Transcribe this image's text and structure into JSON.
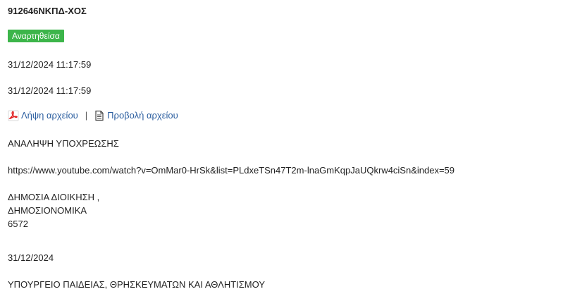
{
  "record": {
    "code": "912646ΝΚΠΔ-ΧΟΣ",
    "status_badge": "Αναρτηθείσα",
    "colors": {
      "badge_bg": "#3cb54a",
      "link": "#2a5d9f"
    },
    "submission_timestamp": "31/12/2024 11:17:59",
    "published_timestamp": "31/12/2024 11:17:59",
    "files": {
      "download_label": "Λήψη αρχείου",
      "download_icon": "pdf-icon",
      "separator": "|",
      "view_label": "Προβολή αρχείου",
      "view_icon": "document-icon"
    },
    "decision_type": "ΑΝΑΛΗΨΗ ΥΠΟΧΡΕΩΣΗΣ",
    "url": "https://www.youtube.com/watch?v=OmMar0-HrSk&list=PLdxeTSn47T2m-lnaGmKqpJaUQkrw4ciSn&index=59",
    "thematic_units": {
      "line1": "ΔΗΜΟΣΙΑ ΔΙΟΙΚΗΣΗ ,",
      "line2": "ΔΗΜΟΣΙΟΝΟΜΙΚΑ",
      "line3": "6572"
    },
    "issue_date": "31/12/2024",
    "organization": "ΥΠΟΥΡΓΕΙΟ ΠΑΙΔΕΙΑΣ, ΘΡΗΣΚΕΥΜΑΤΩΝ ΚΑΙ ΑΘΛΗΤΙΣΜΟΥ"
  }
}
